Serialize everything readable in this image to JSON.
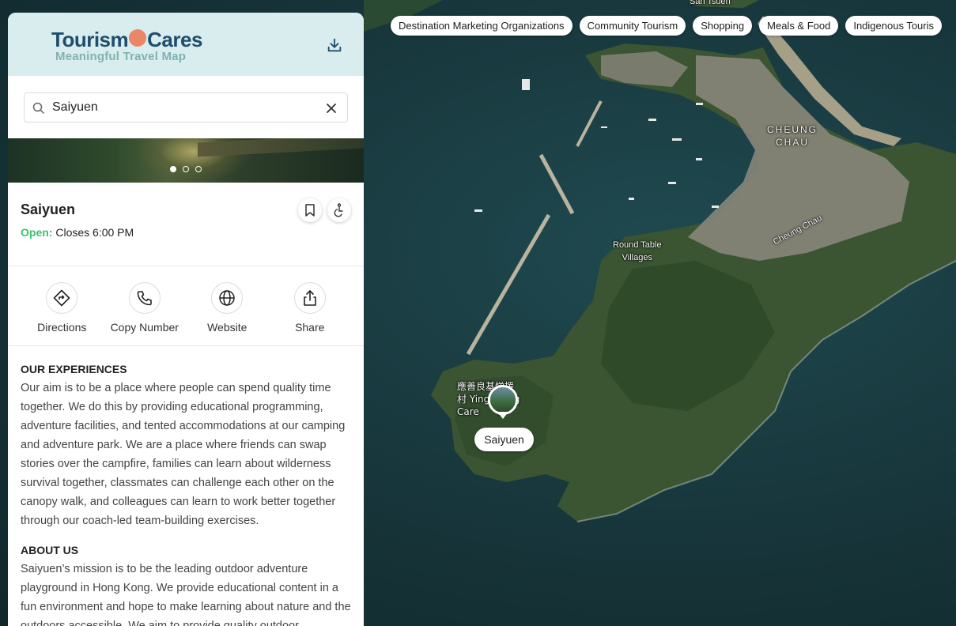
{
  "map": {
    "chips": [
      "Destination Marketing Organizations",
      "Community Tourism",
      "Shopping",
      "Meals & Food",
      "Indigenous Touris"
    ],
    "labels": {
      "san_tsuen": "San Tsuen",
      "cheung_chau": "CHEUNG\nCHAU",
      "round_table": "Round Table\nVillages",
      "cheung_chau_road": "Cheung Chau",
      "cjk_label": "應善良基悌援\n村 Ying    ung\nCare      e"
    },
    "pin_label": "Saiyuen",
    "colors": {
      "water": "#163338",
      "land": "#3d5a34"
    }
  },
  "panel": {
    "logo": {
      "main_left": "Tourism",
      "main_right": "Cares",
      "sub": "Meaningful Travel Map"
    },
    "search": {
      "value": "Saiyuen",
      "placeholder": ""
    },
    "place": {
      "name": "Saiyuen",
      "status_label": "Open:",
      "status_text": "Closes 6:00 PM"
    },
    "actions": [
      {
        "label": "Directions",
        "icon": "directions-icon"
      },
      {
        "label": "Copy Number",
        "icon": "phone-icon"
      },
      {
        "label": "Website",
        "icon": "globe-icon"
      },
      {
        "label": "Share",
        "icon": "share-icon"
      }
    ],
    "sections": [
      {
        "title": "OUR EXPERIENCES",
        "body": "Our aim is to be a place where people can spend quality time together. We do this by providing educational programming, adventure facilities, and tented accommodations at our camping and adventure park. We are a place where friends can swap stories over the campfire, families can learn about wilderness survival together, classmates can challenge each other on the canopy walk, and colleagues can learn to work better together through our coach-led team-building exercises."
      },
      {
        "title": "ABOUT US",
        "body": "Saiyuen’s mission is to be the leading outdoor adventure playground in Hong Kong. We provide educational content in a fun environment and hope to make learning about nature and the outdoors accessible. We aim to provide quality outdoor"
      }
    ],
    "colors": {
      "header_bg": "#d9ecee",
      "open_green": "#3cc26a",
      "logo_blue": "#1e4e6e",
      "logo_teal": "#7fb3b0",
      "logo_orange": "#e98766"
    }
  }
}
